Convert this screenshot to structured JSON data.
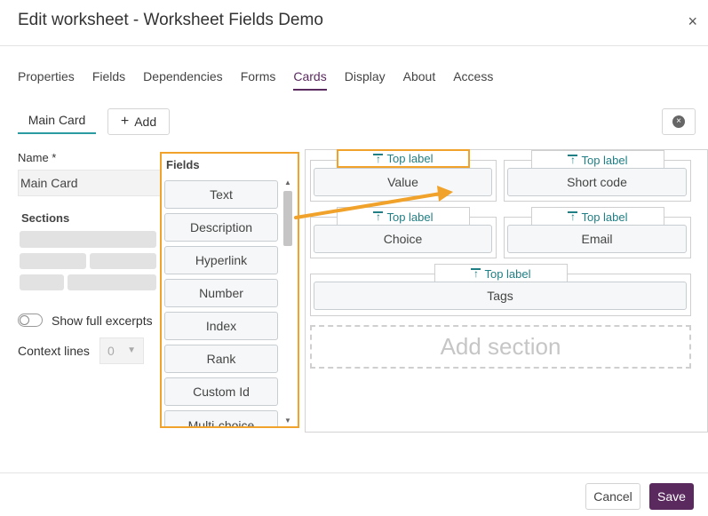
{
  "dialog": {
    "title": "Edit worksheet - Worksheet Fields Demo",
    "close": "×"
  },
  "tabs": [
    "Properties",
    "Fields",
    "Dependencies",
    "Forms",
    "Cards",
    "Display",
    "About",
    "Access"
  ],
  "active_tab": "Cards",
  "card_tabs": {
    "main": "Main Card",
    "add": "Add"
  },
  "form": {
    "name_label": "Name *",
    "name_value": "Main Card",
    "sections_label": "Sections",
    "show_excerpts": "Show full excerpts",
    "context_label": "Context lines",
    "context_value": "0"
  },
  "fields_panel": {
    "title": "Fields",
    "items": [
      "Text",
      "Description",
      "Hyperlink",
      "Number",
      "Index",
      "Rank",
      "Custom Id",
      "Multi-choice"
    ]
  },
  "canvas": {
    "top_label": "Top label",
    "fields": [
      "Value",
      "Short code",
      "Choice",
      "Email",
      "Tags"
    ],
    "add_section": "Add section"
  },
  "footer": {
    "cancel": "Cancel",
    "save": "Save"
  },
  "colors": {
    "accent": "#5a2a5f",
    "teal": "#1f7f84",
    "highlight": "#f0a22a"
  }
}
